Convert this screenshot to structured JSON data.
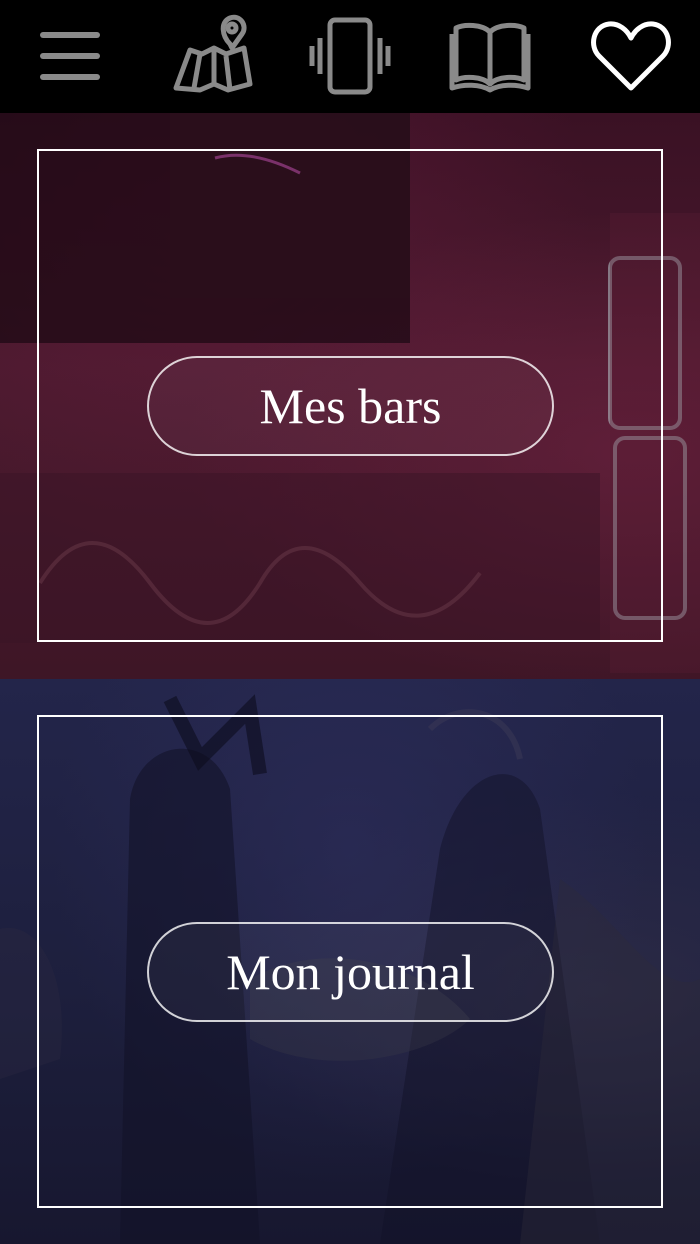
{
  "nav": {
    "items": [
      {
        "icon": "menu-icon",
        "color": "#8a8a8a"
      },
      {
        "icon": "map-pin-icon",
        "color": "#8a8a8a"
      },
      {
        "icon": "phone-vibrate-icon",
        "color": "#8a8a8a"
      },
      {
        "icon": "book-icon",
        "color": "#8a8a8a"
      },
      {
        "icon": "heart-icon",
        "color": "#ffffff"
      }
    ],
    "background": "#000000"
  },
  "sections": {
    "bars": {
      "label": "Mes bars",
      "tint": "#4a1a2e"
    },
    "journal": {
      "label": "Mon journal",
      "tint": "#1d1f3d"
    }
  },
  "colors": {
    "frame_border": "#ffffff",
    "text": "#ffffff",
    "inactive_icon": "#8a8a8a",
    "active_icon": "#ffffff"
  }
}
